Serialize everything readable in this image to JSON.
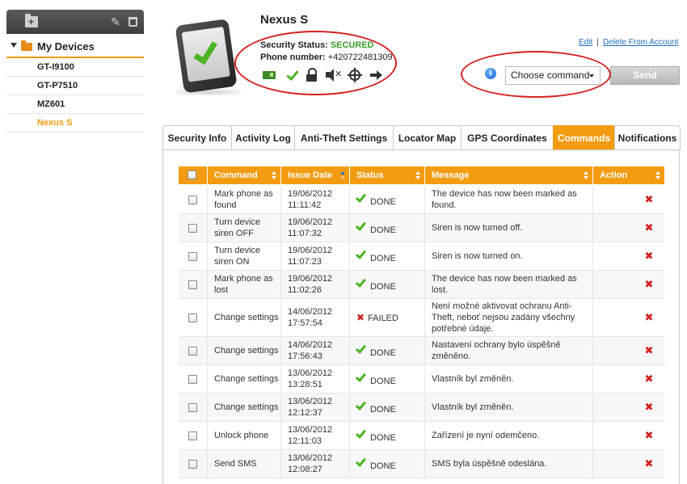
{
  "sidebar": {
    "root_label": "My Devices",
    "devices": [
      "GT-I9100",
      "GT-P7510",
      "MZ601",
      "Nexus S"
    ],
    "active_device": "Nexus S"
  },
  "device": {
    "name": "Nexus S",
    "security_status_label": "Security Status:",
    "security_status_value": "SECURED",
    "phone_number_label": "Phone number:",
    "phone_number_value": "+420722481309"
  },
  "links": {
    "edit": "Edit",
    "separator": "|",
    "delete": "Delete From Account"
  },
  "command_bar": {
    "select_value": "Choose command",
    "send_label": "Send"
  },
  "tabs": [
    {
      "label": "Security Info",
      "active": false
    },
    {
      "label": "Activity Log",
      "active": false
    },
    {
      "label": "Anti-Theft Settings",
      "active": false
    },
    {
      "label": "Locator Map",
      "active": false
    },
    {
      "label": "GPS Coordinates",
      "active": false
    },
    {
      "label": "Commands",
      "active": true
    },
    {
      "label": "Notifications",
      "active": false
    }
  ],
  "table": {
    "headers": {
      "command": "Command",
      "issue_date": "Issue Date",
      "status": "Status",
      "message": "Message",
      "action": "Action"
    },
    "rows": [
      {
        "command": "Mark phone as found",
        "date": "19/06/2012",
        "time": "11:11:42",
        "status": "DONE",
        "message": "The device has now been marked as found."
      },
      {
        "command": "Turn device siren OFF",
        "date": "19/06/2012",
        "time": "11:07:32",
        "status": "DONE",
        "message": "Siren is now turned off."
      },
      {
        "command": "Turn device siren ON",
        "date": "19/06/2012",
        "time": "11:07:23",
        "status": "DONE",
        "message": "Siren is now turned on."
      },
      {
        "command": "Mark phone as lost",
        "date": "19/06/2012",
        "time": "11:02:26",
        "status": "DONE",
        "message": "The device has now been marked as lost."
      },
      {
        "command": "Change settings",
        "date": "14/06/2012",
        "time": "17:57:54",
        "status": "FAILED",
        "message": "Není možné aktivovat ochranu Anti-Theft, neboť nejsou zadány všechny potřebné údaje."
      },
      {
        "command": "Change settings",
        "date": "14/06/2012",
        "time": "17:56:43",
        "status": "DONE",
        "message": "Nastavení ochrany bylo úspěšně změněno."
      },
      {
        "command": "Change settings",
        "date": "13/06/2012",
        "time": "13:28:51",
        "status": "DONE",
        "message": "Vlastník byl změněn."
      },
      {
        "command": "Change settings",
        "date": "13/06/2012",
        "time": "12:12:37",
        "status": "DONE",
        "message": "Vlastník byl změněn."
      },
      {
        "command": "Unlock phone",
        "date": "13/06/2012",
        "time": "12:11:03",
        "status": "DONE",
        "message": "Zařízení je nyní odemčeno."
      },
      {
        "command": "Send SMS",
        "date": "13/06/2012",
        "time": "12:08:27",
        "status": "DONE",
        "message": "SMS byla úspěšně odeslána."
      }
    ]
  },
  "colors": {
    "accent": "#f39c12",
    "secured": "#3aa02a",
    "annotation": "#d42020",
    "link": "#1f6fb8"
  }
}
